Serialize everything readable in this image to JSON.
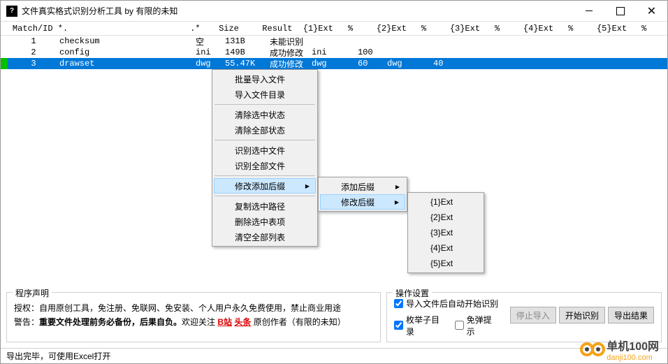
{
  "title": "文件真实格式识别分析工具 by 有限的未知",
  "columns": {
    "match": "Match/ID",
    "name": "*.",
    "star": ".*",
    "size": "Size",
    "result": "Result",
    "e1": "{1}Ext",
    "p1": "%",
    "e2": "{2}Ext",
    "p2": "%",
    "e3": "{3}Ext",
    "p3": "%",
    "e4": "{4}Ext",
    "p4": "%",
    "e5": "{5}Ext",
    "p5": "%"
  },
  "rows": [
    {
      "id": "1",
      "name": "checksum",
      "star": "空",
      "size": "131B",
      "result": "未能识别",
      "e1": "",
      "p1": "",
      "e2": "",
      "p2": ""
    },
    {
      "id": "2",
      "name": "config",
      "star": "ini",
      "size": "149B",
      "result": "成功修改",
      "e1": "ini",
      "p1": "100",
      "e2": "",
      "p2": ""
    },
    {
      "id": "3",
      "name": "drawset",
      "star": "dwg",
      "size": "55.47K",
      "result": "成功修改",
      "e1": "dwg",
      "p1": "60",
      "e2": "dwg",
      "p2": "40"
    }
  ],
  "menu1": {
    "i1": "批量导入文件",
    "i2": "导入文件目录",
    "i3": "清除选中状态",
    "i4": "清除全部状态",
    "i5": "识别选中文件",
    "i6": "识别全部文件",
    "i7": "修改添加后缀",
    "i8": "复制选中路径",
    "i9": "删除选中表项",
    "i10": "清空全部列表"
  },
  "menu2": {
    "i1": "添加后缀",
    "i2": "修改后缀"
  },
  "menu3": {
    "i1": "{1}Ext",
    "i2": "{2}Ext",
    "i3": "{3}Ext",
    "i4": "{4}Ext",
    "i5": "{5}Ext"
  },
  "declare": {
    "title": "程序声明",
    "l1a": "授权：自用原创工具，免注册、免联网、免安装、个人用户永久免费使用，禁止商业用途",
    "l2a": "警告：",
    "l2b": "重要文件处理前务必备份，后果自负。",
    "l2c": "欢迎关注 ",
    "l2d": "B站",
    "l2e": " ",
    "l2f": "头条",
    "l2g": " 原创作者（有限的未知）"
  },
  "ops": {
    "title": "操作设置",
    "cb1": "导入文件后自动开始识别",
    "cb2": "枚举子目录",
    "cb3": "免弹提示",
    "b1": "停止导入",
    "b2": "开始识别",
    "b3": "导出结果"
  },
  "status": "导出完毕，可使用Excel打开",
  "wm": {
    "t1": "单机100网",
    "t2": "danji100.com"
  }
}
